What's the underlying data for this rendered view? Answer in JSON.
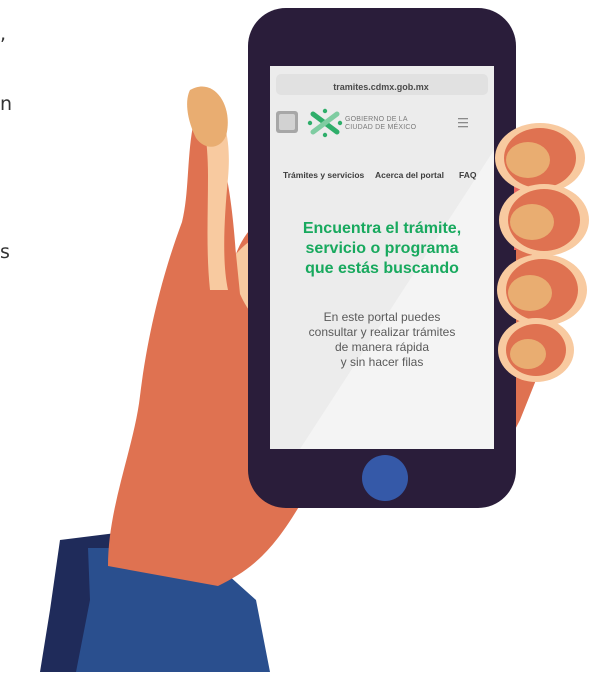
{
  "left_text_fragments": [
    ",",
    "n",
    "s"
  ],
  "phone": {
    "url": "tramites.cdmx.gob.mx",
    "logo": {
      "line1": "GOBIERNO DE LA",
      "line2": "CIUDAD DE MÉXICO"
    },
    "nav": [
      "Trámites y servicios",
      "Acerca del portal",
      "FAQ"
    ],
    "headline": [
      "Encuentra el trámite,",
      "servicio o programa",
      "que estás buscando"
    ],
    "subtitle": [
      "En este portal puedes",
      "consultar y realizar trámites",
      "de manera rápida",
      "y sin hacer filas"
    ]
  },
  "colors": {
    "skin": "#df7251",
    "skin_light": "#f8caa0",
    "nail": "#e9ad71",
    "phone_body": "#2a1d3a",
    "home_button": "#3559a8",
    "sleeve": "#2a4f8e",
    "screen": "#f4f4f4",
    "accent_green": "#18a95e"
  }
}
